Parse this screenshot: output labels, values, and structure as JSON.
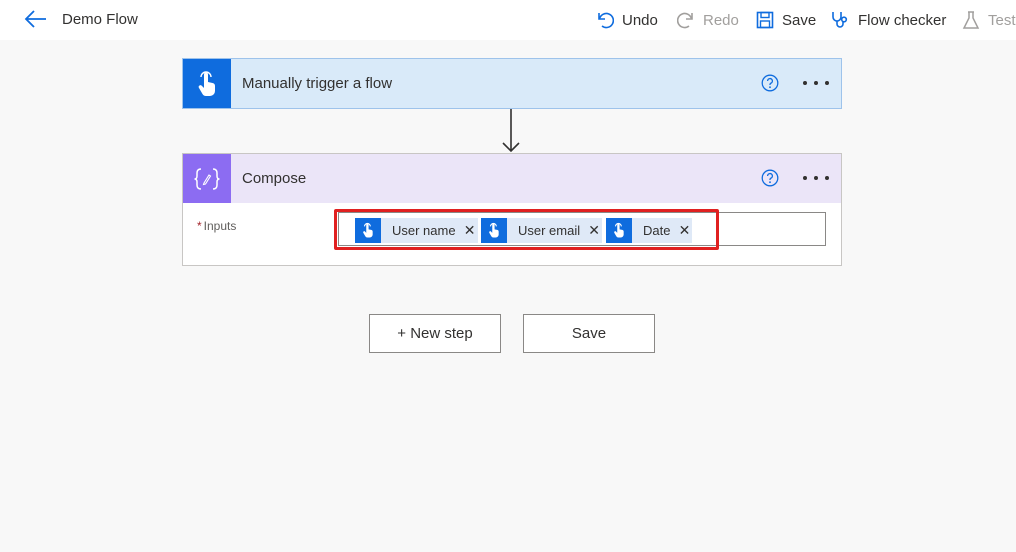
{
  "header": {
    "title": "Demo Flow",
    "undo_label": "Undo",
    "redo_label": "Redo",
    "save_label": "Save",
    "flow_checker_label": "Flow checker",
    "test_label": "Test"
  },
  "trigger_card": {
    "title": "Manually trigger a flow"
  },
  "compose_card": {
    "title": "Compose",
    "inputs_required_marker": "*",
    "inputs_label": "Inputs",
    "tokens": [
      {
        "label": "User name"
      },
      {
        "label": "User email"
      },
      {
        "label": "Date"
      }
    ]
  },
  "actions": {
    "new_step_label": "+ New step",
    "save_label": "Save"
  },
  "colors": {
    "accent": "#0f6cde",
    "compose_accent": "#8c6cf2",
    "highlight": "#e02020"
  }
}
